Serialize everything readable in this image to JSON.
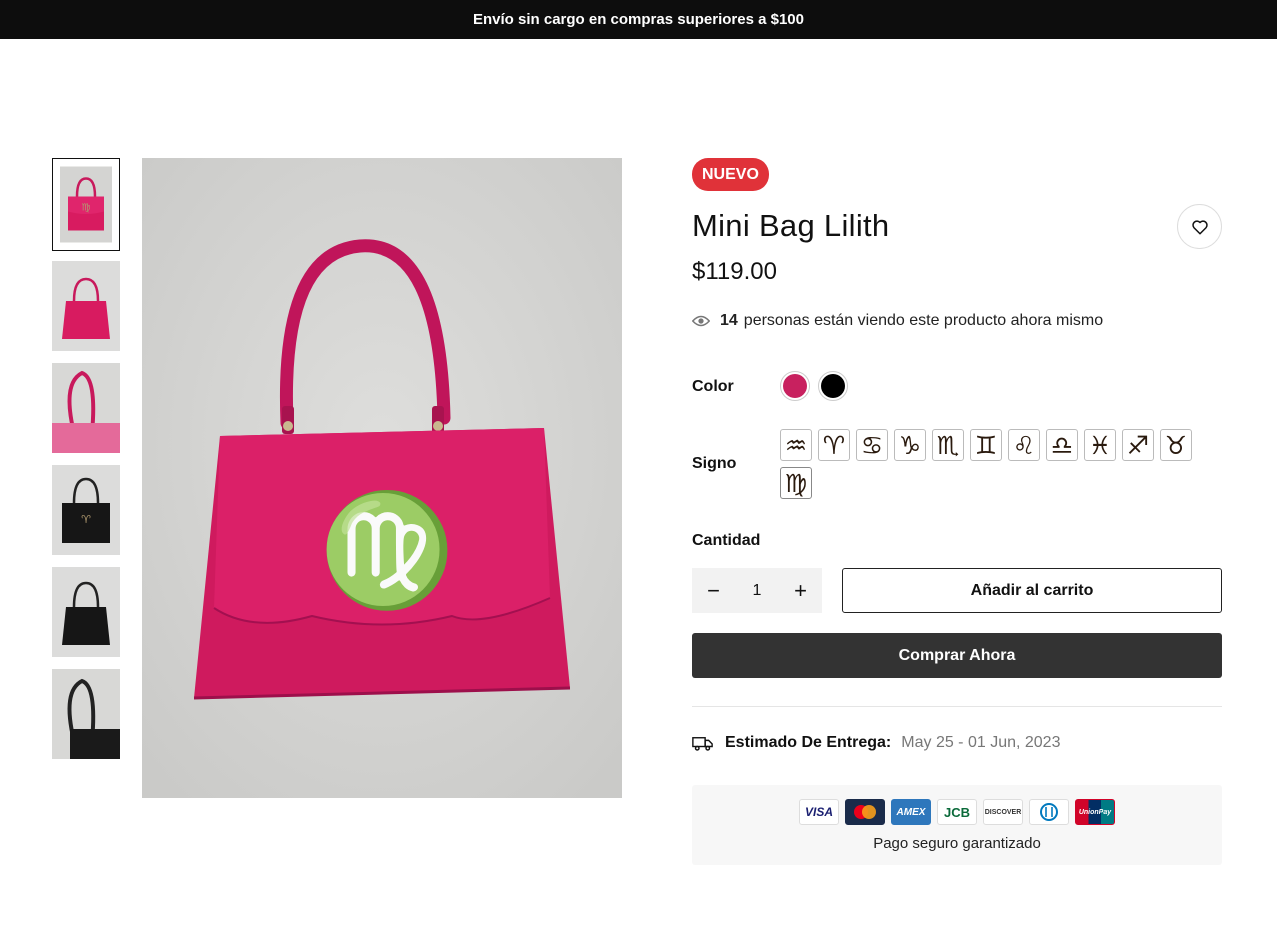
{
  "announcement": "Envío sin cargo en compras superiores a $100",
  "product": {
    "badge": "NUEVO",
    "title": "Mini Bag Lilith",
    "price": "$119.00",
    "viewers_count": "14",
    "viewers_text": "personas están viendo este producto ahora mismo",
    "color_label": "Color",
    "colors": [
      "#c8215f",
      "#000000"
    ],
    "sign_label": "Signo",
    "signs": [
      "♒",
      "♈",
      "♋",
      "♑",
      "♏",
      "♊",
      "♌",
      "♎",
      "♓",
      "♐",
      "♉",
      "♍"
    ],
    "quantity_label": "Cantidad",
    "quantity_value": "1",
    "minus": "−",
    "plus": "+",
    "add_to_cart": "Añadir al carrito",
    "buy_now": "Comprar Ahora",
    "delivery_label": "Estimado De Entrega:",
    "delivery_dates": "May 25 - 01 Jun, 2023",
    "secure_payment": "Pago seguro garantizado"
  },
  "payment_cards": [
    "VISA",
    "mastercard",
    "AMEX",
    "JCB",
    "DISCOVER",
    "diners",
    "UnionPay"
  ],
  "colors": {
    "accent_badge": "#e03239",
    "buy_button": "#333333",
    "topbar": "#0d0d0d",
    "bag_pink": "#d81b60"
  }
}
